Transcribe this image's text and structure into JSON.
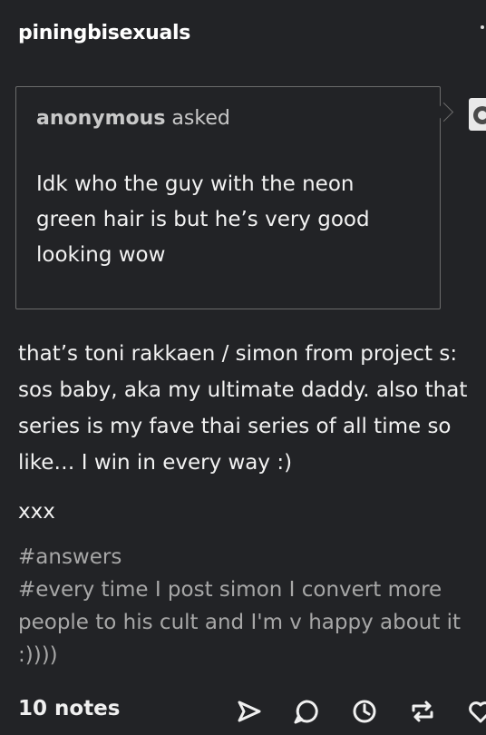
{
  "post": {
    "author": "piningbisexuals",
    "ask": {
      "asker": "anonymous",
      "verb": "asked",
      "question": "Idk who the guy with the neon green hair is but he’s very good looking wow"
    },
    "answer": "that’s toni rakkaen / simon from project s: sos baby, aka my ultimate daddy. also that series is my fave thai series of all time so like… I win in every way :)",
    "signoff": "xxx",
    "tags": [
      "#answers",
      "#every time I post simon I convert more people to his cult and I'm v happy about it :))))"
    ],
    "notes": "10 notes"
  },
  "icons": {
    "share": "send-icon",
    "reply": "comment-icon",
    "history": "clock-icon",
    "reblog": "reblog-icon",
    "like": "heart-icon"
  }
}
